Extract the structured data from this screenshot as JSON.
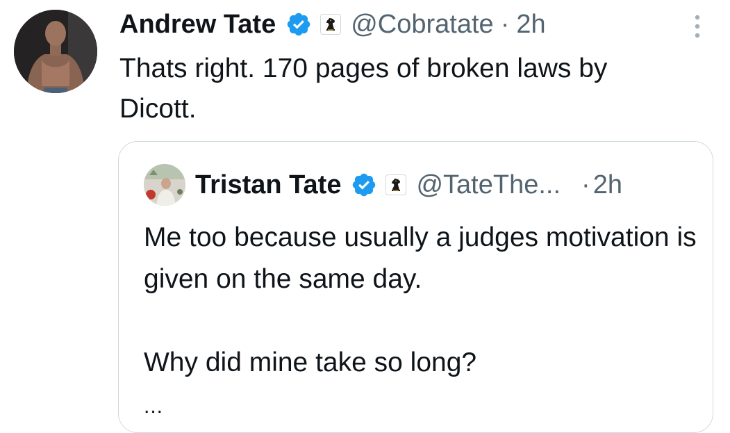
{
  "tweet": {
    "author_name": "Andrew Tate",
    "handle": "@Cobratate",
    "separator": "·",
    "time": "2h",
    "text": "Thats right. 170 pages of broken laws by\nDicott.",
    "icons": {
      "avatar": "profile-avatar",
      "verified": "verified-badge-icon",
      "affiliate": "chess-knight-icon",
      "more": "more-options-icon"
    },
    "colors": {
      "verified_blue": "#1d9bf0",
      "secondary_text": "#536471",
      "primary_text": "#0f1419",
      "border": "#cfd9de"
    }
  },
  "quoted_tweet": {
    "author_name": "Tristan Tate",
    "handle": "@TateThe...",
    "separator": "·",
    "time": "2h",
    "paragraphs": [
      "Me too because usually a judges motivation is given on the same day.",
      "Why did mine take so long?"
    ],
    "truncation": "..."
  }
}
